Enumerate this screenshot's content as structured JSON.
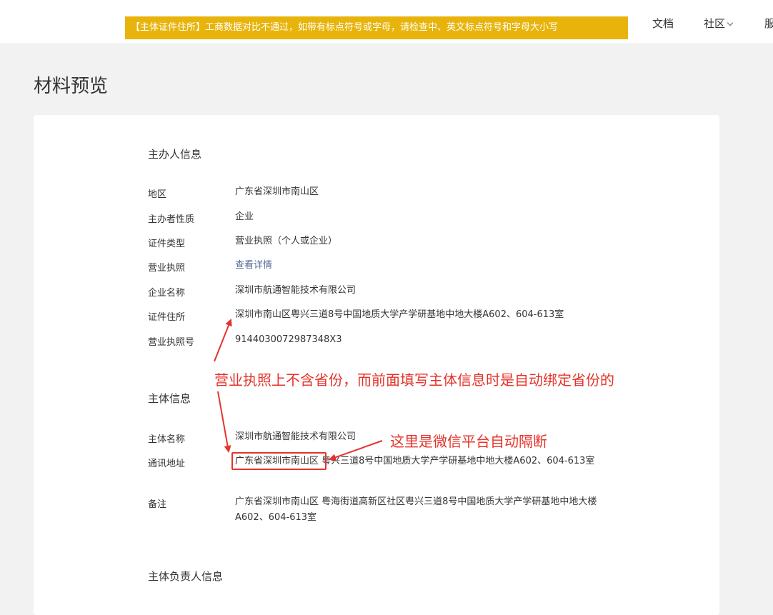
{
  "topbar": {
    "alert": "【主体证件住所】工商数据对比不通过，如带有标点符号或字母，请检查中、英文标点符号和字母大小写",
    "nav": {
      "docs": "文档",
      "community": "社区",
      "service": "服"
    }
  },
  "page": {
    "title": "材料预览"
  },
  "sponsor_info": {
    "heading": "主办人信息",
    "rows": [
      {
        "label": "地区",
        "value": "广东省深圳市南山区"
      },
      {
        "label": "主办者性质",
        "value": "企业"
      },
      {
        "label": "证件类型",
        "value": "营业执照（个人或企业）"
      },
      {
        "label": "营业执照",
        "value": "查看详情"
      },
      {
        "label": "企业名称",
        "value": "深圳市航通智能技术有限公司"
      },
      {
        "label": "证件住所",
        "value": "深圳市南山区粤兴三道8号中国地质大学产学研基地中地大楼A602、604-613室"
      },
      {
        "label": "营业执照号",
        "value": "9144030072987348X3"
      }
    ]
  },
  "subject_info": {
    "heading": "主体信息",
    "rows": [
      {
        "label": "主体名称",
        "value": "深圳市航通智能技术有限公司"
      },
      {
        "label": "通讯地址",
        "value": "广东省深圳市南山区 粤兴三道8号中国地质大学产学研基地中地大楼A602、604-613室"
      },
      {
        "label": "备注",
        "value": "广东省深圳市南山区 粤海街道高新区社区粤兴三道8号中国地质大学产学研基地中地大楼A602、604-613室"
      }
    ]
  },
  "responsible_info": {
    "heading": "主体负责人信息"
  },
  "annotations": {
    "note_1": "营业执照上不含省份，而前面填写主体信息时是自动绑定省份的",
    "note_2": "这里是微信平台自动隔断",
    "color": "#e5332a"
  },
  "colors": {
    "banner": "#e8b40c",
    "link": "#576b95"
  }
}
